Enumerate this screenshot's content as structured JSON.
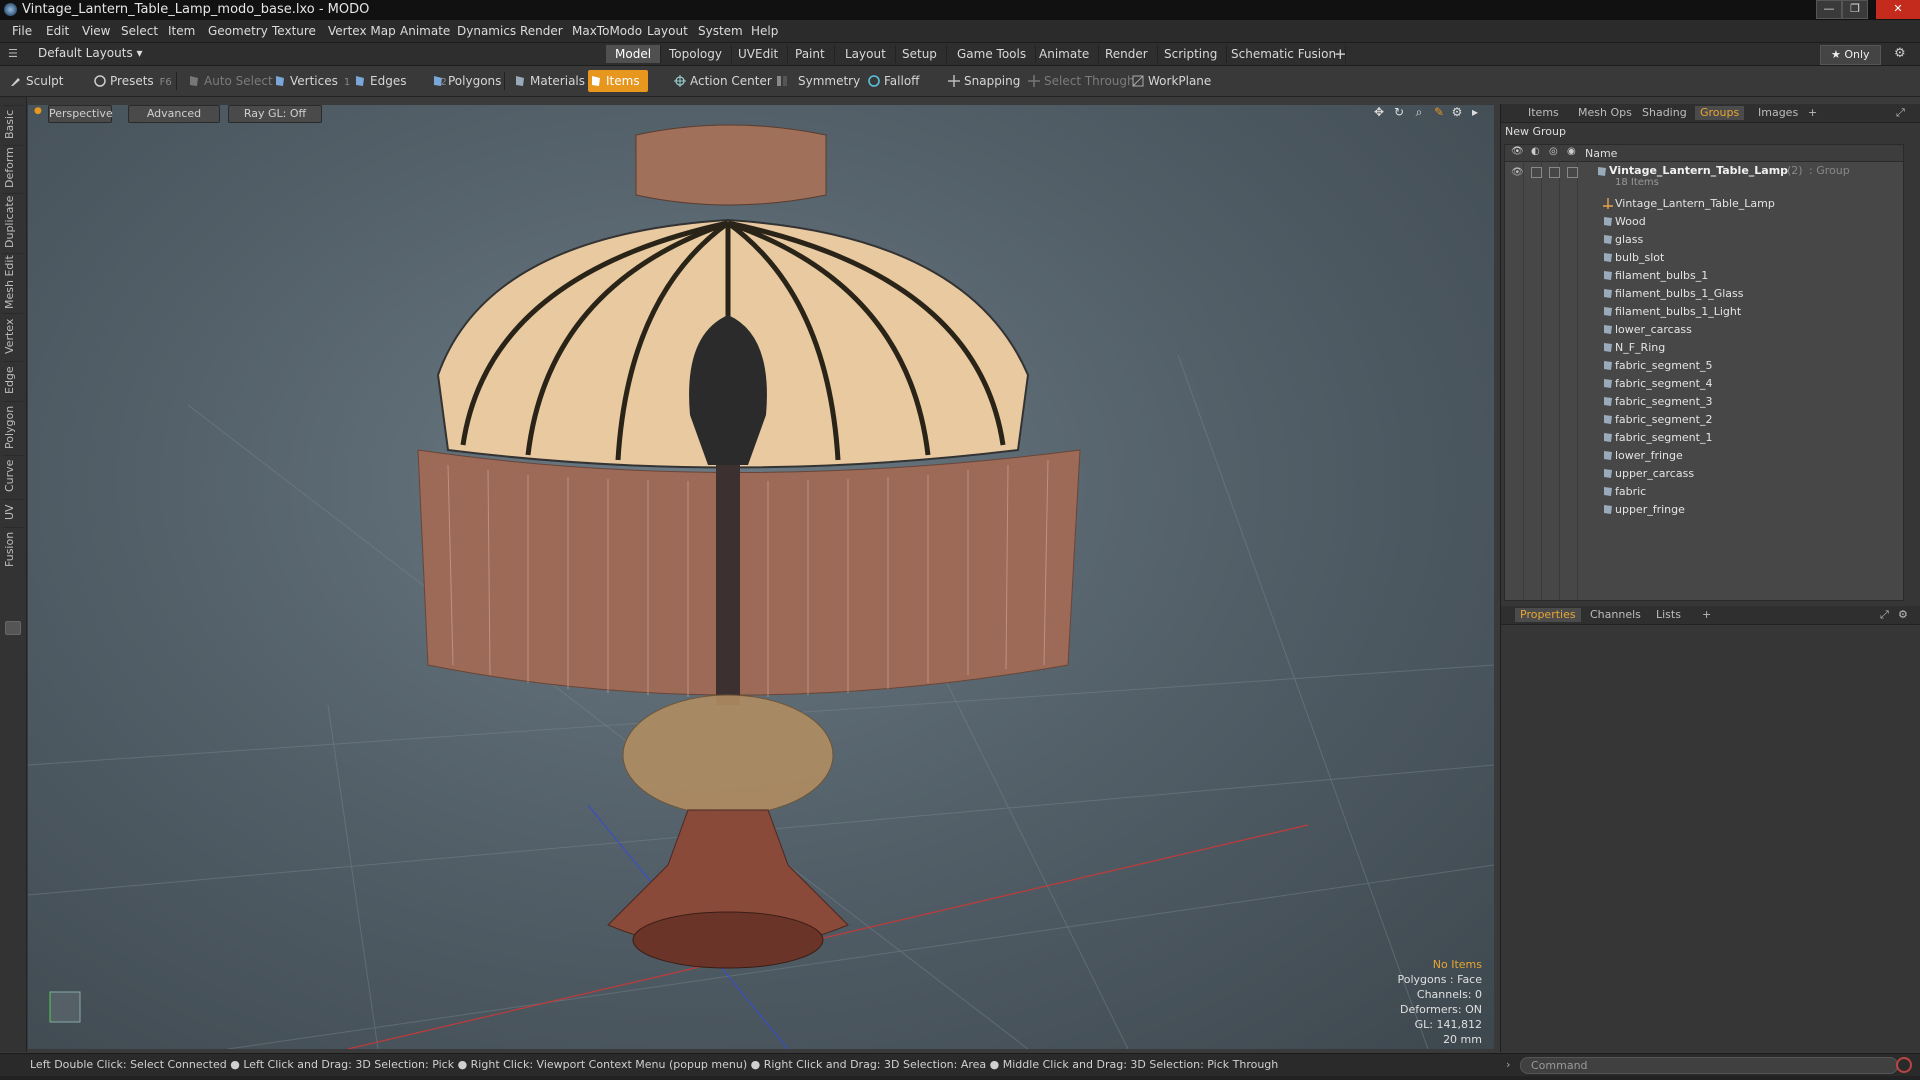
{
  "window": {
    "title": "Vintage_Lantern_Table_Lamp_modo_base.lxo - MODO",
    "controls": [
      "—",
      "❐",
      "✕"
    ]
  },
  "menu": [
    "File",
    "Edit",
    "View",
    "Select",
    "Item",
    "Geometry",
    "Texture",
    "Vertex Map",
    "Animate",
    "Dynamics",
    "Render",
    "MaxToModo",
    "Layout",
    "System",
    "Help"
  ],
  "layoutbar": {
    "layout_label": "Default Layouts ▾",
    "tabs": [
      "Model",
      "Topology",
      "UVEdit",
      "Paint",
      "Layout",
      "Setup",
      "Game Tools",
      "Animate",
      "Render",
      "Scripting",
      "Schematic Fusion"
    ],
    "active_tab": "Model",
    "add": "+",
    "only_label": "★ Only"
  },
  "toolbar": {
    "sculpt": "Sculpt",
    "presets": "Presets",
    "presets_key": "F6",
    "auto_select": "Auto Select",
    "vertices": "Vertices",
    "vertices_key": "1",
    "edges": "Edges",
    "edges_key": "2",
    "polygons": "Polygons",
    "materials": "Materials",
    "items": "Items",
    "action_center": "Action Center",
    "symmetry": "Symmetry",
    "falloff": "Falloff",
    "snapping": "Snapping",
    "select_through": "Select Through",
    "workplane": "WorkPlane"
  },
  "left_tabs": [
    "Basic",
    "Deform",
    "Duplicate",
    "Mesh Edit",
    "Vertex",
    "Edge",
    "Polygon",
    "Curve",
    "UV",
    "Fusion"
  ],
  "viewport": {
    "view_mode": "Perspective",
    "shading": "Advanced",
    "raygl": "Ray GL: Off",
    "info": {
      "selection": "No Items",
      "polygons": "Polygons : Face",
      "channels": "Channels: 0",
      "deformers": "Deformers: ON",
      "gl": "GL: 141,812",
      "unit": "20 mm"
    }
  },
  "status_bar": "Left Double Click: Select Connected ● Left Click and Drag: 3D Selection: Pick ● Right Click: Viewport Context Menu (popup menu) ● Right Click and Drag: 3D Selection: Area ● Middle Click and Drag: 3D Selection: Pick Through",
  "command": {
    "placeholder": "Command"
  },
  "right_panel": {
    "tabs": [
      "Items",
      "Mesh Ops",
      "Shading",
      "Groups",
      "Images"
    ],
    "active_tab": "Groups",
    "add": "+",
    "new_group": "New Group",
    "col_name": "Name",
    "group": {
      "name": "Vintage_Lantern_Table_Lamp",
      "count": "(2)",
      "type": ": Group",
      "items_count": "18 Items"
    },
    "items": [
      "Vintage_Lantern_Table_Lamp",
      "Wood",
      "glass",
      "bulb_slot",
      "filament_bulbs_1",
      "filament_bulbs_1_Glass",
      "filament_bulbs_1_Light",
      "lower_carcass",
      "N_F_Ring",
      "fabric_segment_5",
      "fabric_segment_4",
      "fabric_segment_3",
      "fabric_segment_2",
      "fabric_segment_1",
      "lower_fringe",
      "upper_carcass",
      "fabric",
      "upper_fringe"
    ],
    "bottom_tabs": [
      "Properties",
      "Channels",
      "Lists"
    ],
    "bottom_active": "Properties"
  },
  "colors": {
    "accent": "#e7961e",
    "panel": "#363636",
    "viewport_center": "#6b7a84"
  }
}
